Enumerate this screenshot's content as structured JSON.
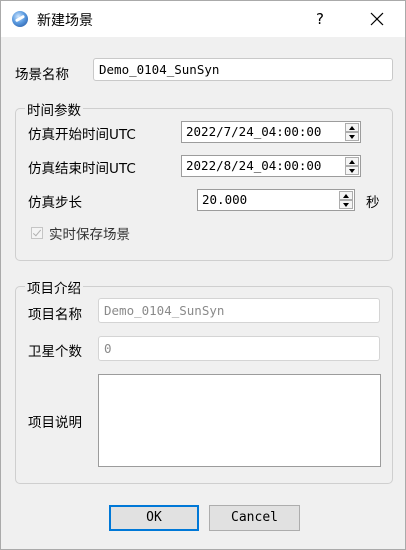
{
  "window": {
    "title": "新建场景",
    "help_label": "?",
    "icon": "app-globe-icon",
    "close_icon": "close-icon"
  },
  "scene": {
    "name_label": "场景名称",
    "name_value": "Demo_0104_SunSyn"
  },
  "time_group": {
    "title": "时间参数",
    "start_label": "仿真开始时间UTC",
    "start_value": "2022/7/24_04:00:00",
    "end_label": "仿真结束时间UTC",
    "end_value": "2022/8/24_04:00:00",
    "step_label": "仿真步长",
    "step_value": "20.000",
    "step_unit": "秒",
    "realtime_save_label": "实时保存场景",
    "realtime_save_checked": true
  },
  "project_group": {
    "title": "项目介绍",
    "name_label": "项目名称",
    "name_value": "Demo_0104_SunSyn",
    "satellite_count_label": "卫星个数",
    "satellite_count_value": "0",
    "description_label": "项目说明",
    "description_value": ""
  },
  "buttons": {
    "ok": "OK",
    "cancel": "Cancel"
  },
  "colors": {
    "default_button_border": "#0078d7",
    "titlebar": "#ffffff",
    "dialog_bg": "#f0f0f0"
  }
}
